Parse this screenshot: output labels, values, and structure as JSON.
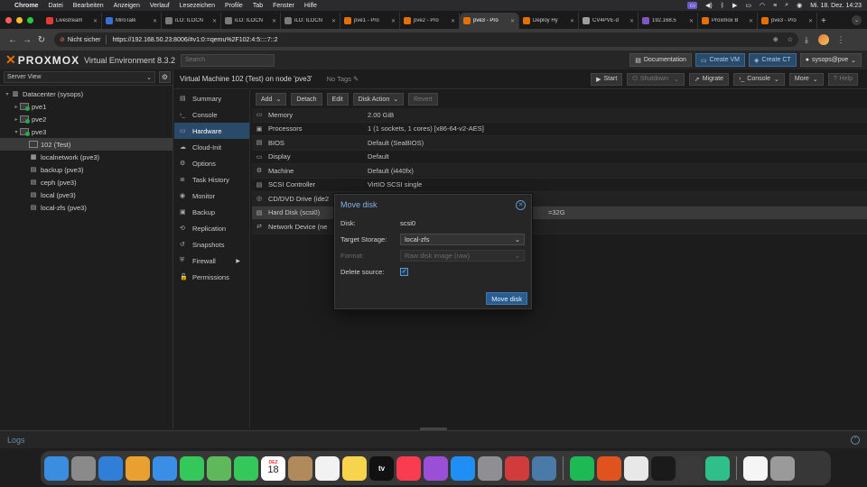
{
  "menubar": {
    "app": "Chrome",
    "items": [
      "Datei",
      "Bearbeiten",
      "Anzeigen",
      "Verlauf",
      "Lesezeichen",
      "Profile",
      "Tab",
      "Fenster",
      "Hilfe"
    ],
    "clock": "Mi. 18. Dez.  14:23"
  },
  "tabs": [
    {
      "title": "Livestream",
      "color": "#e53935"
    },
    {
      "title": "MiroTalk",
      "color": "#3b6fd1"
    },
    {
      "title": "iLO: ILOCN",
      "color": "#7a7a7a"
    },
    {
      "title": "iLO: ILOCN",
      "color": "#7a7a7a"
    },
    {
      "title": "iLO: ILOCN",
      "color": "#7a7a7a"
    },
    {
      "title": "pve1 - Pro",
      "color": "#e57000"
    },
    {
      "title": "pve2 - Pro",
      "color": "#e57000"
    },
    {
      "title": "pve3 - Pro",
      "color": "#e57000"
    },
    {
      "title": "Deploy Hy",
      "color": "#e57000"
    },
    {
      "title": "CV4PVE-d",
      "color": "#9e9e9e"
    },
    {
      "title": "192.168.5",
      "color": "#7e57c2"
    },
    {
      "title": "Proxmox B",
      "color": "#e57000"
    },
    {
      "title": "pve3 - Pro",
      "color": "#e57000"
    }
  ],
  "active_tab_index": 7,
  "address": {
    "security": "Nicht sicher",
    "url": "https://192.168.50.23:8006/#v1:0:=qemu%2F102:4:5::::7::2"
  },
  "pve": {
    "brand": "PROXMOX",
    "product": "Virtual Environment 8.3.2",
    "search_placeholder": "Search",
    "documentation": "Documentation",
    "create_vm": "Create VM",
    "create_ct": "Create CT",
    "user": "sysops@pve"
  },
  "tree": {
    "view": "Server View",
    "nodes": [
      {
        "label": "Datacenter (sysops)",
        "level": 0,
        "type": "datacenter"
      },
      {
        "label": "pve1",
        "level": 1,
        "type": "server"
      },
      {
        "label": "pve2",
        "level": 1,
        "type": "server"
      },
      {
        "label": "pve3",
        "level": 1,
        "type": "server"
      },
      {
        "label": "102 (Test)",
        "level": 2,
        "type": "vm"
      },
      {
        "label": "localnetwork (pve3)",
        "level": 2,
        "type": "network"
      },
      {
        "label": "backup (pve3)",
        "level": 2,
        "type": "storage"
      },
      {
        "label": "ceph (pve3)",
        "level": 2,
        "type": "storage"
      },
      {
        "label": "local (pve3)",
        "level": 2,
        "type": "storage"
      },
      {
        "label": "local-zfs (pve3)",
        "level": 2,
        "type": "storage"
      }
    ]
  },
  "content": {
    "title": "Virtual Machine 102 (Test) on node 'pve3'",
    "tags": "No Tags",
    "buttons": {
      "start": "Start",
      "shutdown": "Shutdown",
      "migrate": "Migrate",
      "console": "Console",
      "more": "More",
      "help": "Help"
    }
  },
  "submenu": [
    {
      "label": "Summary",
      "icon": "summary-icon"
    },
    {
      "label": "Console",
      "icon": "terminal-icon"
    },
    {
      "label": "Hardware",
      "icon": "monitor-icon"
    },
    {
      "label": "Cloud-Init",
      "icon": "cloud-icon"
    },
    {
      "label": "Options",
      "icon": "gear-icon"
    },
    {
      "label": "Task History",
      "icon": "list-icon"
    },
    {
      "label": "Monitor",
      "icon": "eye-icon"
    },
    {
      "label": "Backup",
      "icon": "floppy-icon"
    },
    {
      "label": "Replication",
      "icon": "retweet-icon"
    },
    {
      "label": "Snapshots",
      "icon": "history-icon"
    },
    {
      "label": "Firewall",
      "icon": "shield-icon"
    },
    {
      "label": "Permissions",
      "icon": "unlock-icon"
    }
  ],
  "hardware": {
    "toolbar": {
      "add": "Add",
      "detach": "Detach",
      "edit": "Edit",
      "disk_action": "Disk Action",
      "revert": "Revert"
    },
    "rows": [
      {
        "key": "Memory",
        "value": "2.00 GiB"
      },
      {
        "key": "Processors",
        "value": "1 (1 sockets, 1 cores) [x86-64-v2-AES]"
      },
      {
        "key": "BIOS",
        "value": "Default (SeaBIOS)"
      },
      {
        "key": "Display",
        "value": "Default"
      },
      {
        "key": "Machine",
        "value": "Default (i440fx)"
      },
      {
        "key": "SCSI Controller",
        "value": "VirtIO SCSI single"
      },
      {
        "key": "CD/DVD Drive (ide2",
        "value": ""
      },
      {
        "key": "Hard Disk (scsi0)",
        "value": "=32G"
      },
      {
        "key": "Network Device (ne",
        "value": ""
      }
    ]
  },
  "modal": {
    "title": "Move disk",
    "disk_label": "Disk:",
    "disk_value": "scsi0",
    "target_label": "Target Storage:",
    "target_value": "local-zfs",
    "format_label": "Format:",
    "format_value": "Raw disk image (raw)",
    "delete_label": "Delete source:",
    "delete_checked": true,
    "submit": "Move disk"
  },
  "logs": {
    "label": "Logs"
  },
  "dock": [
    {
      "name": "Finder",
      "color": "#3b8de0"
    },
    {
      "name": "Launchpad",
      "color": "#8a8a8a"
    },
    {
      "name": "Safari",
      "color": "#2f7fd8"
    },
    {
      "name": "Photos",
      "color": "#e8a030"
    },
    {
      "name": "Mail",
      "color": "#3a8ee6"
    },
    {
      "name": "Messages",
      "color": "#34c759"
    },
    {
      "name": "Maps",
      "color": "#5fb85a"
    },
    {
      "name": "FaceTime",
      "color": "#34c759"
    },
    {
      "name": "Calendar",
      "color": "#ffffff"
    },
    {
      "name": "Contacts",
      "color": "#b08a5a"
    },
    {
      "name": "Reminders",
      "color": "#f2f2f2"
    },
    {
      "name": "Notes",
      "color": "#f7d44c"
    },
    {
      "name": "TV",
      "color": "#111111"
    },
    {
      "name": "Music",
      "color": "#fa3c50"
    },
    {
      "name": "Podcasts",
      "color": "#9b4fd6"
    },
    {
      "name": "App Store",
      "color": "#1f8ff5"
    },
    {
      "name": "System Settings",
      "color": "#8e8e93"
    },
    {
      "name": "Authy",
      "color": "#d23b3b"
    },
    {
      "name": "Proxyman",
      "color": "#4a7aa8"
    },
    {
      "name": "Spotify",
      "color": "#1db954"
    },
    {
      "name": "Brave",
      "color": "#e0531e"
    },
    {
      "name": "Chrome",
      "color": "#e8e8e8"
    },
    {
      "name": "Terminal",
      "color": "#1a1a1a"
    },
    {
      "name": "Calculator",
      "color": "#3a3a3a"
    },
    {
      "name": "Cursor",
      "color": "#2fbf8a"
    },
    {
      "name": "Document",
      "color": "#f5f5f5"
    },
    {
      "name": "Trash",
      "color": "#9a9a9a"
    }
  ],
  "dock_labels": {
    "calendar_month": "DEZ",
    "calendar_day": "18",
    "tv": "tv"
  }
}
